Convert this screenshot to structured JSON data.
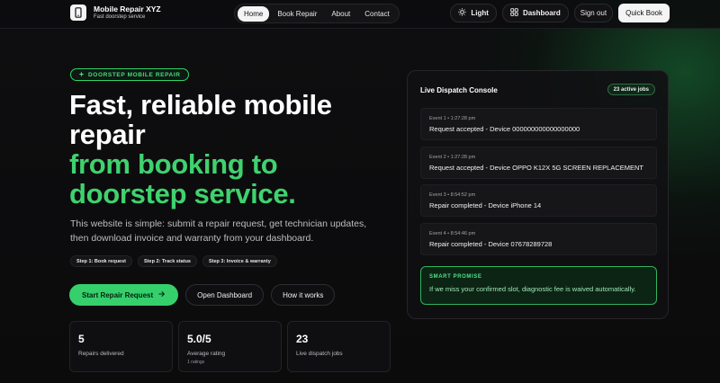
{
  "header": {
    "brand_name": "Mobile Repair XYZ",
    "brand_tagline": "Fast doorstep service",
    "nav": [
      "Home",
      "Book Repair",
      "About",
      "Contact"
    ],
    "light_label": "Light",
    "dashboard_label": "Dashboard",
    "signout_label": "Sign out",
    "quickbook_label": "Quick Book"
  },
  "hero": {
    "badge": "DOORSTEP MOBILE REPAIR",
    "title_line1": "Fast, reliable mobile",
    "title_line2": "repair",
    "title_line3": "from booking to",
    "title_line4": "doorstep service.",
    "lead": "This website is simple: submit a repair request, get technician updates, then download invoice and warranty from your dashboard.",
    "steps": [
      "Step 1: Book request",
      "Step 2: Track status",
      "Step 3: Invoice & warranty"
    ],
    "cta_primary": "Start Repair Request",
    "cta_dashboard": "Open Dashboard",
    "cta_how": "How it works"
  },
  "stats": [
    {
      "value": "5",
      "label": "Repairs delivered",
      "sub": ""
    },
    {
      "value": "5.0/5",
      "label": "Average rating",
      "sub": "1 ratings"
    },
    {
      "value": "23",
      "label": "Live dispatch jobs",
      "sub": ""
    }
  ],
  "console": {
    "title": "Live Dispatch Console",
    "badge": "23 active jobs",
    "events": [
      {
        "meta": "Event 1 • 1:27:28 pm",
        "msg": "Request accepted - Device 000000000000000000"
      },
      {
        "meta": "Event 2 • 1:27:28 pm",
        "msg": "Request accepted - Device OPPO K12X 5G SCREEN REPLACEMENT"
      },
      {
        "meta": "Event 3 • 8:54:52 pm",
        "msg": "Repair completed - Device iPhone 14"
      },
      {
        "meta": "Event 4 • 8:54:46 pm",
        "msg": "Repair completed - Device 07678289728"
      }
    ],
    "promise_title": "SMART PROMISE",
    "promise_text": "If we miss your confirmed slot, diagnostic fee is waived automatically."
  },
  "colors": {
    "accent": "#3fd26e",
    "background": "#0b0b0c"
  }
}
